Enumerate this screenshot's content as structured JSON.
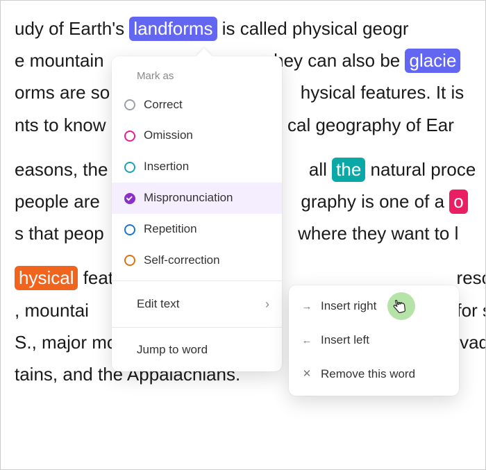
{
  "text": {
    "l1a": "udy of Earth's ",
    "l1hl": "landforms",
    "l1b": " is called physical geogr",
    "l2a": "e mountain",
    "l2b": "hey can also be ",
    "l2hl": "glacie",
    "l3a": "orms are so",
    "l3b": "hysical features. It is",
    "l4a": "nts to know",
    "l4b": "cal geography of Ear",
    "l5a": "easons, the",
    "l5b": "all ",
    "l5hl": "the",
    "l5c": " natural proce",
    "l6a": " people are",
    "l6b": "graphy is one of a ",
    "l6hl": "o",
    "l7a": "s that peop",
    "l7b": "where they want to l",
    "l8hl": "hysical",
    "l8a": " feat",
    "l8b": "reso",
    "l9a": ", mountai",
    "l9b": "for s",
    "l10": "S., major mountain ranges a",
    "l10b": "vada",
    "l11": "tains, and the Appalachians."
  },
  "menu": {
    "header": "Mark as",
    "items": [
      {
        "label": "Correct"
      },
      {
        "label": "Omission"
      },
      {
        "label": "Insertion"
      },
      {
        "label": "Mispronunciation"
      },
      {
        "label": "Repetition"
      },
      {
        "label": "Self-correction"
      }
    ],
    "edit_text": "Edit text",
    "jump": "Jump to word"
  },
  "submenu": {
    "insert_right": "Insert right",
    "insert_left": "Insert left",
    "remove": "Remove this word"
  },
  "colors": {
    "purple": "#6366f1",
    "teal": "#0aa8a7",
    "pink": "#e91e63",
    "orange": "#f0641e"
  }
}
